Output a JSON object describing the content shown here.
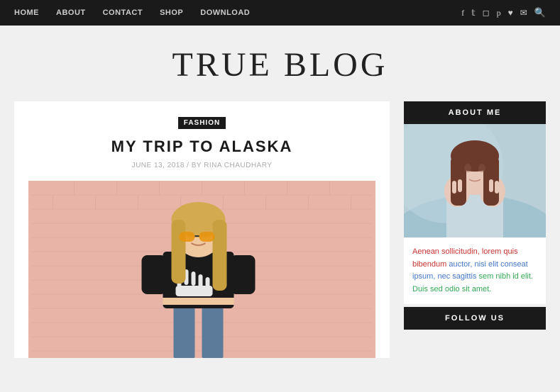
{
  "nav": {
    "items": [
      {
        "label": "HOME",
        "id": "home"
      },
      {
        "label": "ABOUT",
        "id": "about"
      },
      {
        "label": "CONTACT",
        "id": "contact"
      },
      {
        "label": "SHOP",
        "id": "shop"
      },
      {
        "label": "DOWNLOAD",
        "id": "download"
      }
    ],
    "social_icons": [
      "f",
      "t",
      "i",
      "p",
      "♥",
      "✉"
    ],
    "search_label": "🔍"
  },
  "site": {
    "title": "TRUE BLOG"
  },
  "post": {
    "category": "FASHION",
    "title": "MY TRIP TO ALASKA",
    "meta": "JUNE 13, 2018 / BY RINA CHAUDHARY"
  },
  "sidebar": {
    "about_title": "ABOUT ME",
    "about_text_1": "Aenean sollicitudin, lorem quis bibendum auctor, nisi elit conseat ipsum, nec sagittis sem nibh id elit. Duis sed odio sit amet.",
    "follow_title": "FOLLOW US"
  }
}
